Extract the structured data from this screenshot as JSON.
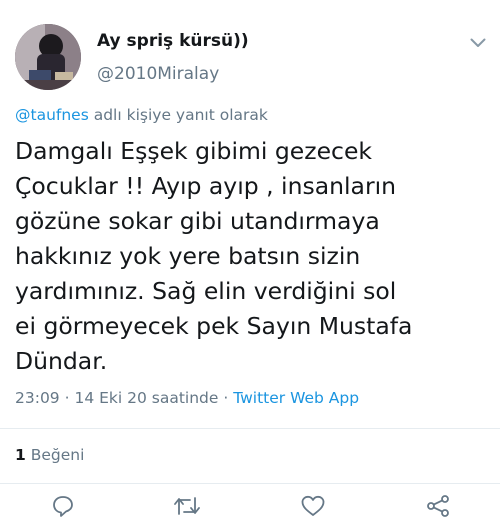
{
  "author": {
    "display_name": "Ay spriş kürsü))",
    "handle": "@2010Miralay",
    "avatar_icon": "profile-photo"
  },
  "reply_to": {
    "mention": "@taufnes",
    "suffix": " adlı kişiye yanıt olarak"
  },
  "tweet": {
    "text": "Damgalı Eşşek gibimi gezecek\nÇocuklar !! Ayıp ayıp ,  insanların\ngözüne sokar gibi utandırmaya\nhakkınız yok yere batsın sizin\nyardımınız. Sağ elin verdiğini sol\nei görmeyecek pek Sayın Mustafa\nDündar."
  },
  "meta": {
    "time": "23:09",
    "separator": " · ",
    "date": "14 Eki 20 saatinde",
    "separator2": " · ",
    "source": "Twitter Web App"
  },
  "stats": {
    "likes_count": "1",
    "likes_label": " Beğeni"
  },
  "actions": [
    {
      "name": "reply",
      "icon": "reply-icon"
    },
    {
      "name": "retweet",
      "icon": "retweet-icon"
    },
    {
      "name": "like",
      "icon": "heart-icon"
    },
    {
      "name": "share",
      "icon": "share-icon"
    }
  ],
  "colors": {
    "link": "#1b95e0",
    "secondary_text": "#657786",
    "primary_text": "#14171a",
    "divider": "#e6ecf0"
  }
}
